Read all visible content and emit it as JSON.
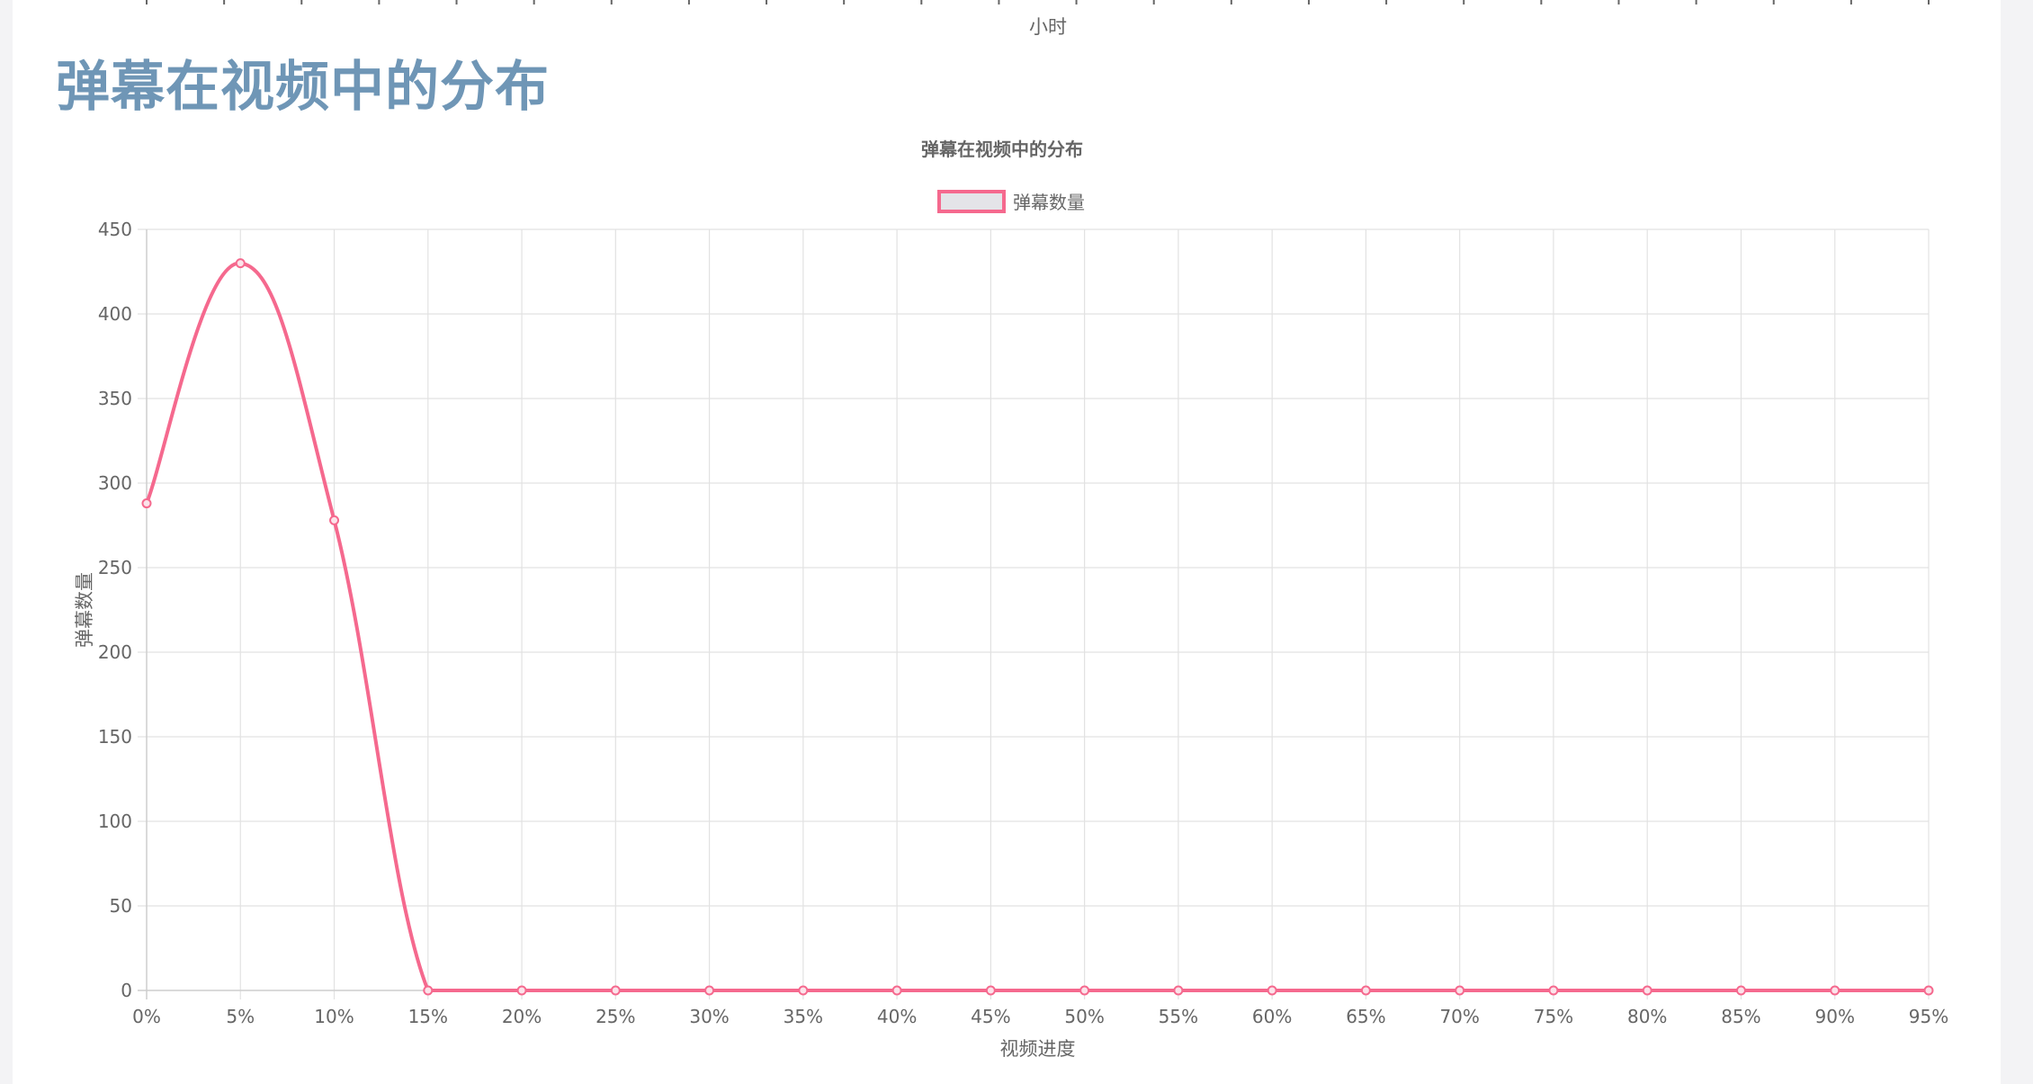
{
  "previous_chart": {
    "x_axis_label": "小时"
  },
  "section": {
    "heading": "弹幕在视频中的分布"
  },
  "chart_data": {
    "type": "line",
    "title": "弹幕在视频中的分布",
    "xlabel": "视频进度",
    "ylabel": "弹幕数量",
    "categories": [
      "0%",
      "5%",
      "10%",
      "15%",
      "20%",
      "25%",
      "30%",
      "35%",
      "40%",
      "45%",
      "50%",
      "55%",
      "60%",
      "65%",
      "70%",
      "75%",
      "80%",
      "85%",
      "90%",
      "95%"
    ],
    "series": [
      {
        "name": "弹幕数量",
        "values": [
          288,
          430,
          278,
          0,
          0,
          0,
          0,
          0,
          0,
          0,
          0,
          0,
          0,
          0,
          0,
          0,
          0,
          0,
          0,
          0
        ],
        "color": "#f5698e"
      }
    ],
    "ylim": [
      0,
      450
    ],
    "yticks": [
      0,
      50,
      100,
      150,
      200,
      250,
      300,
      350,
      400,
      450
    ],
    "grid": true,
    "legend_position": "top-center"
  }
}
